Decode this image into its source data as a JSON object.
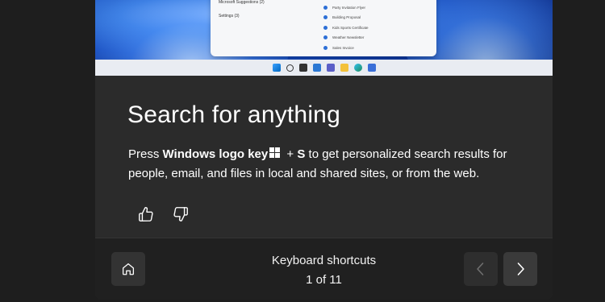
{
  "hero": {
    "popup_left": [
      "Microsoft Suggestions (2)",
      "Settings (3)"
    ],
    "popup_right": [
      "Party Invitation Flyer",
      "Building Proposal",
      "Kids Sports Certificate",
      "Weather Newsletter",
      "Sales Invoice"
    ]
  },
  "tip": {
    "title": "Search for anything",
    "desc_pre": "Press ",
    "desc_key": "Windows logo key",
    "desc_plus": " + ",
    "desc_s": "S",
    "desc_post": " to get personalized search results for people, email, and files in local and shared sites, or from the web."
  },
  "footer": {
    "collection": "Keyboard shortcuts",
    "page": "1 of 11"
  },
  "colors": {
    "background": "#1e1e1e",
    "card": "#2b2b2b",
    "footer": "#202020",
    "button": "#333333"
  },
  "icons": [
    "thumbs-up-icon",
    "thumbs-down-icon",
    "home-icon",
    "chevron-left-icon",
    "chevron-right-icon",
    "windows-logo-icon"
  ]
}
